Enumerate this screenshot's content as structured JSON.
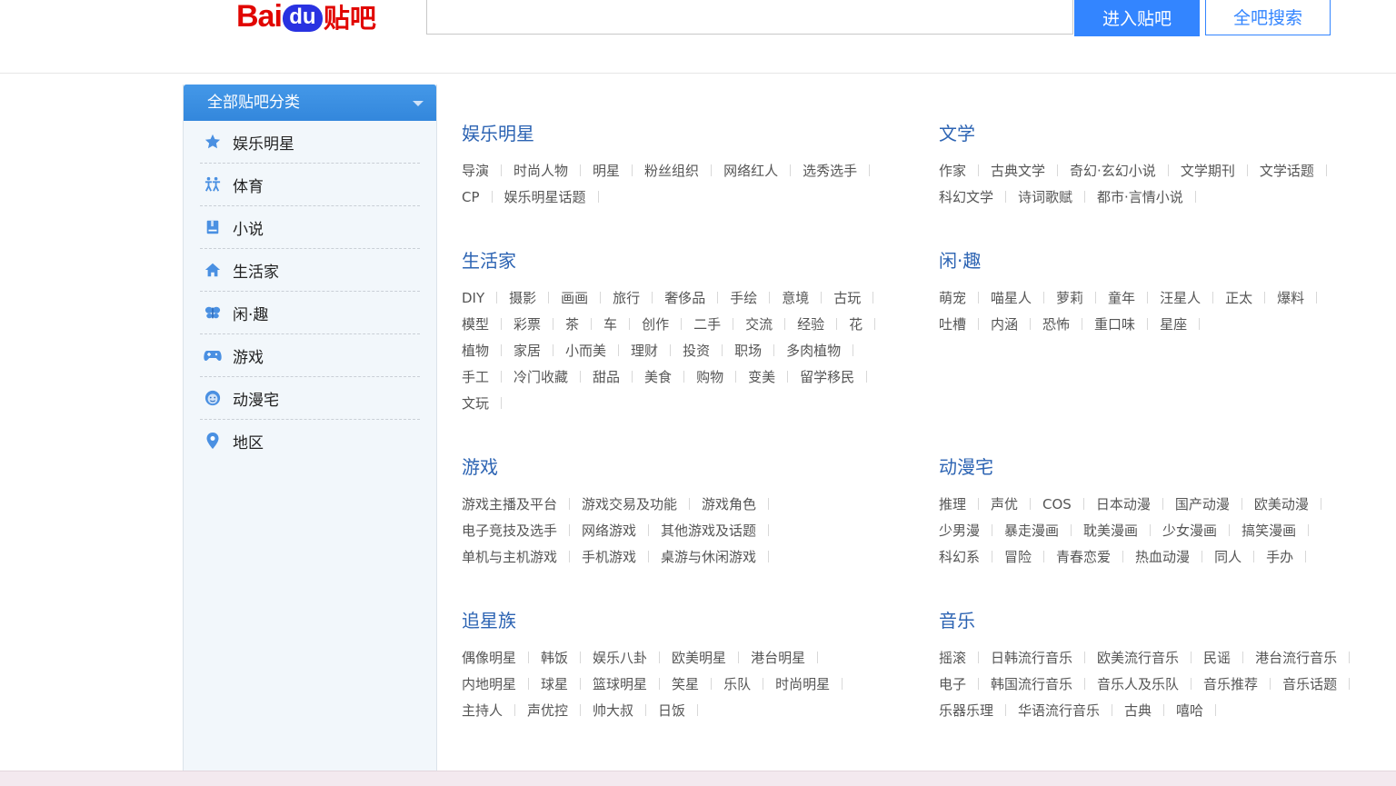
{
  "header": {
    "logo_bai": "Bai",
    "logo_du": "du",
    "logo_tieba": "贴吧",
    "search_value": "",
    "enter_button": "进入贴吧",
    "search_button": "全吧搜索"
  },
  "sidebar": {
    "title": "全部贴吧分类",
    "items": [
      {
        "label": "娱乐明星",
        "icon": "star-icon"
      },
      {
        "label": "体育",
        "icon": "sport-icon"
      },
      {
        "label": "小说",
        "icon": "book-icon"
      },
      {
        "label": "生活家",
        "icon": "home-icon"
      },
      {
        "label": "闲·趣",
        "icon": "butterfly-icon"
      },
      {
        "label": "游戏",
        "icon": "gamepad-icon"
      },
      {
        "label": "动漫宅",
        "icon": "smiley-icon"
      },
      {
        "label": "地区",
        "icon": "location-pin-icon"
      }
    ]
  },
  "sections": [
    {
      "title": "娱乐明星",
      "tags": [
        "导演",
        "时尚人物",
        "明星",
        "粉丝组织",
        "网络红人",
        "选秀选手",
        "CP",
        "娱乐明星话题"
      ]
    },
    {
      "title": "文学",
      "tags": [
        "作家",
        "古典文学",
        "奇幻·玄幻小说",
        "文学期刊",
        "文学话题",
        "科幻文学",
        "诗词歌赋",
        "都市·言情小说"
      ]
    },
    {
      "title": "生活家",
      "tags": [
        "DIY",
        "摄影",
        "画画",
        "旅行",
        "奢侈品",
        "手绘",
        "意境",
        "古玩",
        "模型",
        "彩票",
        "茶",
        "车",
        "创作",
        "二手",
        "交流",
        "经验",
        "花",
        "植物",
        "家居",
        "小而美",
        "理财",
        "投资",
        "职场",
        "多肉植物",
        "手工",
        "冷门收藏",
        "甜品",
        "美食",
        "购物",
        "变美",
        "留学移民",
        "文玩"
      ]
    },
    {
      "title": "闲·趣",
      "tags": [
        "萌宠",
        "喵星人",
        "萝莉",
        "童年",
        "汪星人",
        "正太",
        "爆料",
        "吐槽",
        "内涵",
        "恐怖",
        "重口味",
        "星座"
      ]
    },
    {
      "title": "游戏",
      "tags": [
        "游戏主播及平台",
        "游戏交易及功能",
        "游戏角色",
        "电子竞技及选手",
        "网络游戏",
        "其他游戏及话题",
        "单机与主机游戏",
        "手机游戏",
        "桌游与休闲游戏"
      ]
    },
    {
      "title": "动漫宅",
      "tags": [
        "推理",
        "声优",
        "COS",
        "日本动漫",
        "国产动漫",
        "欧美动漫",
        "少男漫",
        "暴走漫画",
        "耽美漫画",
        "少女漫画",
        "搞笑漫画",
        "科幻系",
        "冒险",
        "青春恋爱",
        "热血动漫",
        "同人",
        "手办"
      ]
    },
    {
      "title": "追星族",
      "tags": [
        "偶像明星",
        "韩饭",
        "娱乐八卦",
        "欧美明星",
        "港台明星",
        "内地明星",
        "球星",
        "篮球明星",
        "笑星",
        "乐队",
        "时尚明星",
        "主持人",
        "声优控",
        "帅大叔",
        "日饭"
      ]
    },
    {
      "title": "音乐",
      "tags": [
        "摇滚",
        "日韩流行音乐",
        "欧美流行音乐",
        "民谣",
        "港台流行音乐",
        "电子",
        "韩国流行音乐",
        "音乐人及乐队",
        "音乐推荐",
        "音乐话题",
        "乐器乐理",
        "华语流行音乐",
        "古典",
        "嘻哈"
      ]
    }
  ]
}
